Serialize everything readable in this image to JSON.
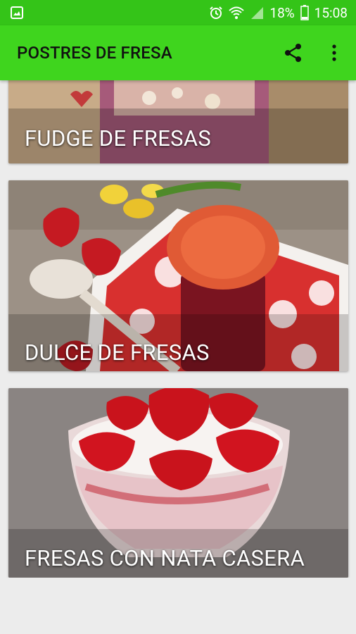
{
  "statusbar": {
    "battery": "18%",
    "time": "15:08",
    "icons": [
      "gallery-icon",
      "alarm-icon",
      "wifi-icon",
      "signal-icon",
      "battery-icon"
    ]
  },
  "appbar": {
    "title": "POSTRES DE FRESA",
    "actions": [
      "share-icon",
      "more-vert-icon"
    ],
    "color": "#3fd51e"
  },
  "recipes": [
    {
      "title": "FUDGE DE FRESAS"
    },
    {
      "title": "DULCE DE FRESAS"
    },
    {
      "title": "FRESAS CON NATA CASERA"
    }
  ]
}
